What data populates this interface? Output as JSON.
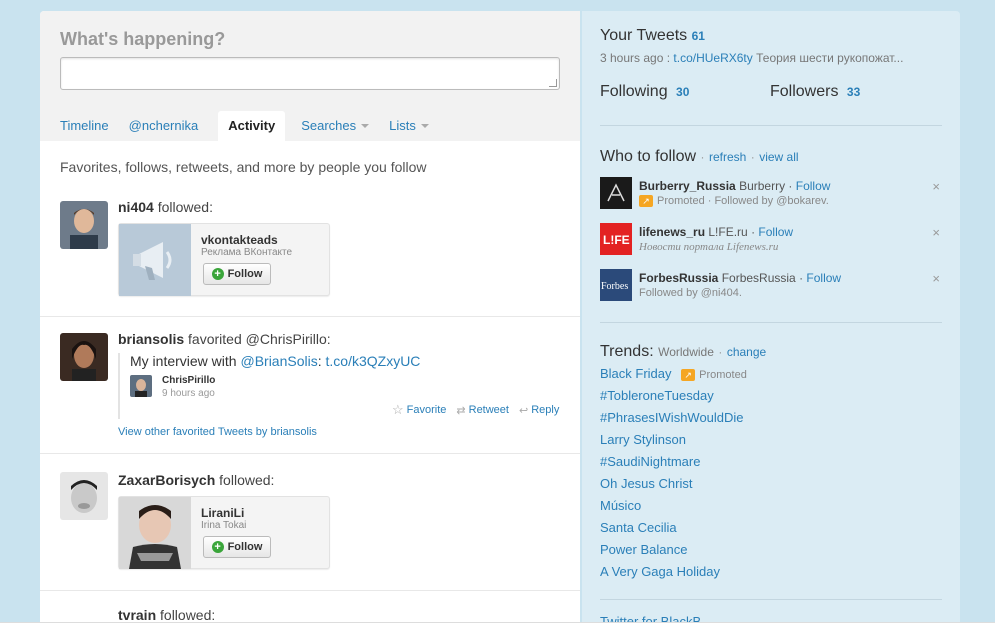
{
  "composer": {
    "heading": "What's happening?"
  },
  "tabs": [
    {
      "label": "Timeline"
    },
    {
      "label": "@nchernika"
    },
    {
      "label": "Activity"
    },
    {
      "label": "Searches"
    },
    {
      "label": "Lists"
    }
  ],
  "stream_header": "Favorites, follows, retweets, and more by people you follow",
  "activity": {
    "item1": {
      "actor": "ni404",
      "verb": "followed:",
      "card_name": "vkontakteads",
      "card_sub": "Реклама ВКонтакте",
      "follow_label": "Follow"
    },
    "item2": {
      "actor": "briansolis",
      "verb": "favorited",
      "target": "@ChrisPirillo:",
      "tweet_prefix": "My interview with",
      "tweet_mention": "@BrianSolis",
      "tweet_colon": ":",
      "tweet_link": "t.co/k3QZxyUC",
      "author": "ChrisPirillo",
      "time": "9 hours ago",
      "favorite": "Favorite",
      "retweet": "Retweet",
      "reply": "Reply",
      "view_other": "View other favorited Tweets by briansolis"
    },
    "item3": {
      "actor": "ZaxarBorisych",
      "verb": "followed:",
      "card_name": "LiraniLi",
      "card_sub": "Irina Tokai",
      "follow_label": "Follow"
    },
    "item4": {
      "actor": "tvrain",
      "verb": "followed:"
    }
  },
  "sidebar": {
    "your_tweets": "Your Tweets",
    "tweets_count": "61",
    "last_tweet_time": "3 hours ago :",
    "last_tweet_link": "t.co/HUeRX6ty",
    "last_tweet_text": "Теория шести рукопожат...",
    "following_label": "Following",
    "following_count": "30",
    "followers_label": "Followers",
    "followers_count": "33",
    "who_to_follow": "Who to follow",
    "refresh": "refresh",
    "view_all": "view all",
    "suggestions": [
      {
        "handle": "Burberry_Russia",
        "name": "Burberry",
        "follow": "Follow",
        "line2": "Promoted · Followed by @bokarev."
      },
      {
        "handle": "lifenews_ru",
        "name": "L!FE.ru",
        "follow": "Follow",
        "line2": "Новости портала Lifenews.ru"
      },
      {
        "handle": "ForbesRussia",
        "name": "ForbesRussia",
        "follow": "Follow",
        "line2": "Followed by @ni404."
      }
    ],
    "trends_label": "Trends:",
    "trends_region": "Worldwide",
    "trends_change": "change",
    "promoted_label": "Promoted",
    "trends": [
      "Black Friday",
      "#TobleroneTuesday",
      "#PhrasesIWishWouldDie",
      "Larry Stylinson",
      "#SaudiNightmare",
      "Oh Jesus Christ",
      "Músico",
      "Santa Cecilia",
      "Power Balance",
      "A Very Gaga Holiday"
    ],
    "footer_partial": "Twitter for BlackB..."
  }
}
